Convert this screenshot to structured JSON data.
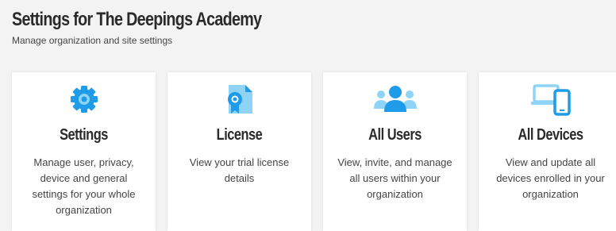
{
  "page": {
    "title": "Settings for The Deepings Academy",
    "subtitle": "Manage organization and site settings"
  },
  "colors": {
    "accent": "#1e9be9",
    "accent_light": "#8fd3f7",
    "card_bg": "#ffffff",
    "page_bg": "#f3f3f3"
  },
  "cards": [
    {
      "title": "Settings",
      "description": "Manage user, privacy, device and general settings for your whole organization",
      "icon": "gear-icon"
    },
    {
      "title": "License",
      "description": "View your trial license details",
      "icon": "license-icon"
    },
    {
      "title": "All Users",
      "description": "View, invite, and manage all users within your organization",
      "icon": "users-icon"
    },
    {
      "title": "All Devices",
      "description": "View and update all devices enrolled in your organization",
      "icon": "devices-icon"
    }
  ]
}
